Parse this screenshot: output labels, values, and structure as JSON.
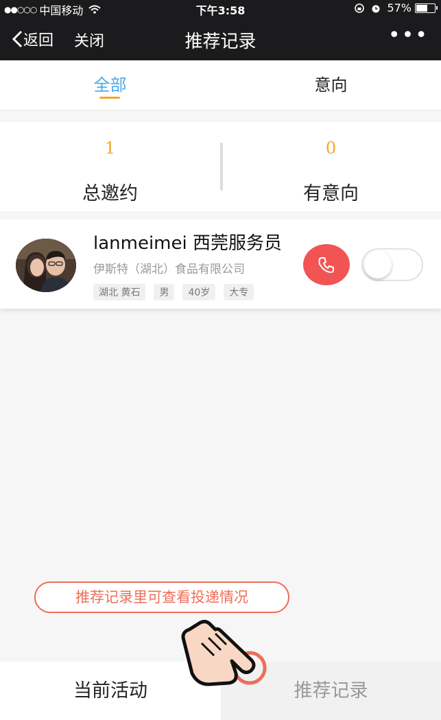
{
  "status_bar": {
    "carrier": "中国移动",
    "time": "下午3:58",
    "battery": "57%"
  },
  "nav": {
    "back_label": "返回",
    "close_label": "关闭",
    "title": "推荐记录",
    "more_label": "•••"
  },
  "tabs": [
    {
      "label": "全部",
      "active": true
    },
    {
      "label": "意向",
      "active": false
    }
  ],
  "stats": {
    "total": {
      "value": "1",
      "label": "总邀约"
    },
    "intent": {
      "value": "0",
      "label": "有意向"
    }
  },
  "candidates": [
    {
      "name": "lanmeimei 西莞服务员",
      "company": "伊斯特（湖北）食品有限公司",
      "tags": [
        "湖北 黄石",
        "男",
        "40岁",
        "大专"
      ],
      "toggle_on": false
    }
  ],
  "hint": "推荐记录里可查看投递情况",
  "bottom_tabs": {
    "current": "当前活动",
    "records": "推荐记录"
  },
  "colors": {
    "accent_blue": "#4aa8ea",
    "accent_orange": "#f5a623",
    "call_red": "#f25454",
    "hint_red": "#ee6e5a",
    "bar_dark": "#1b1b1d"
  },
  "icons": [
    "signal-dots-icon",
    "wifi-icon",
    "lock-rotation-icon",
    "alarm-icon",
    "battery-icon",
    "back-chevron-icon",
    "more-icon",
    "phone-icon",
    "hand-pointer-icon"
  ]
}
